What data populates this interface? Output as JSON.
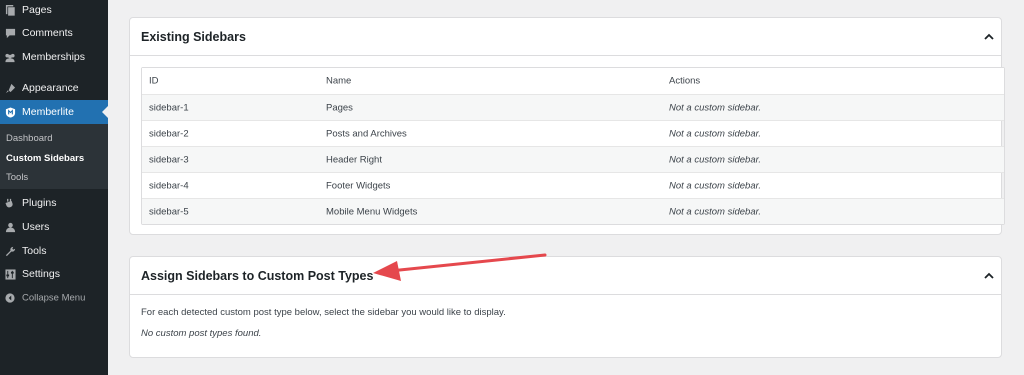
{
  "sidebar": {
    "items": [
      {
        "label": "Pages",
        "icon": "pages-icon"
      },
      {
        "label": "Comments",
        "icon": "comments-icon"
      },
      {
        "label": "Memberships",
        "icon": "memberships-icon"
      },
      {
        "label": "Appearance",
        "icon": "appearance-icon"
      },
      {
        "label": "Memberlite",
        "icon": "memberlite-icon"
      },
      {
        "label": "Plugins",
        "icon": "plugins-icon"
      },
      {
        "label": "Users",
        "icon": "users-icon"
      },
      {
        "label": "Tools",
        "icon": "tools-icon"
      },
      {
        "label": "Settings",
        "icon": "settings-icon"
      }
    ],
    "submenu": [
      "Dashboard",
      "Custom Sidebars",
      "Tools"
    ],
    "collapse_label": "Collapse Menu"
  },
  "existing": {
    "title": "Existing Sidebars",
    "columns": [
      "ID",
      "Name",
      "Actions"
    ],
    "rows": [
      {
        "id": "sidebar-1",
        "name": "Pages",
        "action": "Not a custom sidebar."
      },
      {
        "id": "sidebar-2",
        "name": "Posts and Archives",
        "action": "Not a custom sidebar."
      },
      {
        "id": "sidebar-3",
        "name": "Header Right",
        "action": "Not a custom sidebar."
      },
      {
        "id": "sidebar-4",
        "name": "Footer Widgets",
        "action": "Not a custom sidebar."
      },
      {
        "id": "sidebar-5",
        "name": "Mobile Menu Widgets",
        "action": "Not a custom sidebar."
      }
    ]
  },
  "assign": {
    "title": "Assign Sidebars to Custom Post Types",
    "description": "For each detected custom post type below, select the sidebar you would like to display.",
    "empty": "No custom post types found."
  },
  "colors": {
    "sidebar_bg": "#1d2327",
    "active_blue": "#2271b1",
    "annotation_red": "#e5484d"
  }
}
